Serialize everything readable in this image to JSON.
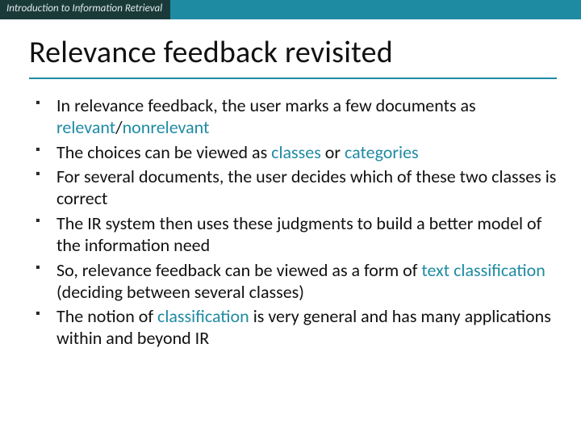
{
  "header": {
    "course": "Introduction to Information Retrieval"
  },
  "title": "Relevance feedback revisited",
  "bullets": [
    {
      "pre": "In relevance feedback, the user marks a few documents as ",
      "kw1": "relevant",
      "mid": "/",
      "kw2": "nonrelevant",
      "post": ""
    },
    {
      "pre": "The choices can be viewed as ",
      "kw1": "classes",
      "mid": " or ",
      "kw2": "categories",
      "post": ""
    },
    {
      "pre": "For several documents, the user decides which of these two classes is correct",
      "kw1": "",
      "mid": "",
      "kw2": "",
      "post": ""
    },
    {
      "pre": "The IR system then uses these judgments to build a better model of the information need",
      "kw1": "",
      "mid": "",
      "kw2": "",
      "post": ""
    },
    {
      "pre": "So, relevance feedback can be viewed as a form of ",
      "kw1": "text classification",
      "mid": "",
      "kw2": "",
      "post": " (deciding between several classes)"
    },
    {
      "pre": "The notion of ",
      "kw1": "classification",
      "mid": "",
      "kw2": "",
      "post": " is very general and has many applications within and beyond IR"
    }
  ]
}
